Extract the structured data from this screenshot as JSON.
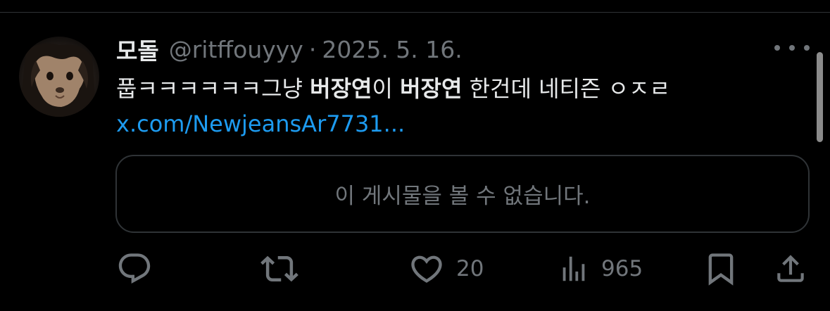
{
  "tweet": {
    "display_name": "모돌",
    "handle": "@ritffouyyy",
    "separator": "·",
    "date": "2025. 5. 16.",
    "text_parts": {
      "p1": "풉ㅋㅋㅋㅋㅋㅋ그냥 ",
      "b1": "버장연",
      "p2": "이 ",
      "b2": "버장연",
      "p3": " 한건데 네티즌 ㅇㅈㄹ"
    },
    "link": "x.com/NewjeansAr7731..."
  },
  "quote": {
    "unavailable_text": "이 게시물을 볼 수 없습니다."
  },
  "actions": {
    "reply": {
      "icon": "reply-icon",
      "count": ""
    },
    "retweet": {
      "icon": "retweet-icon",
      "count": ""
    },
    "like": {
      "icon": "heart-icon",
      "count": "20"
    },
    "views": {
      "icon": "views-icon",
      "count": "965"
    },
    "bookmark": {
      "icon": "bookmark-icon"
    },
    "share": {
      "icon": "share-icon"
    }
  },
  "colors": {
    "background": "#000000",
    "text": "#e7e9ea",
    "muted": "#71767b",
    "link": "#1d9bf0",
    "border": "#2f3336"
  }
}
